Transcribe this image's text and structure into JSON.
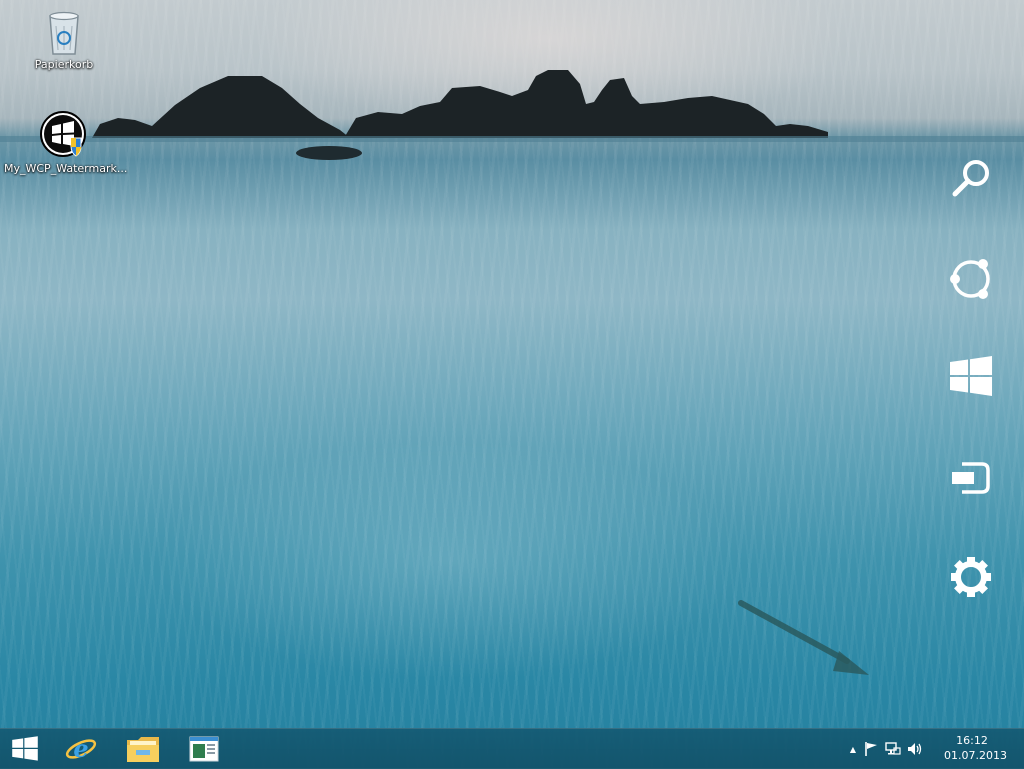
{
  "desktop": {
    "icons": [
      {
        "label": "Papierkorb",
        "icon": "recycle-bin-icon"
      },
      {
        "label": "My_WCP_Watermark...",
        "icon": "windows-shield-icon"
      }
    ]
  },
  "charms": [
    {
      "name": "search",
      "icon": "search-icon"
    },
    {
      "name": "share",
      "icon": "share-icon"
    },
    {
      "name": "start",
      "icon": "windows-logo-icon"
    },
    {
      "name": "devices",
      "icon": "devices-icon"
    },
    {
      "name": "settings",
      "icon": "gear-icon"
    }
  ],
  "taskbar": {
    "pinned": [
      {
        "name": "start",
        "icon": "windows-logo-icon"
      },
      {
        "name": "internet-explorer",
        "icon": "ie-icon"
      },
      {
        "name": "file-explorer",
        "icon": "folder-icon"
      },
      {
        "name": "app-window",
        "icon": "window-icon"
      }
    ],
    "tray": {
      "chevron": "▲",
      "icons": [
        "flag-icon",
        "network-icon",
        "speaker-icon"
      ]
    },
    "clock": {
      "time": "16:12",
      "date": "01.07.2013"
    }
  },
  "colors": {
    "accent": "#1f6f8b",
    "taskbar": "#145a73"
  }
}
